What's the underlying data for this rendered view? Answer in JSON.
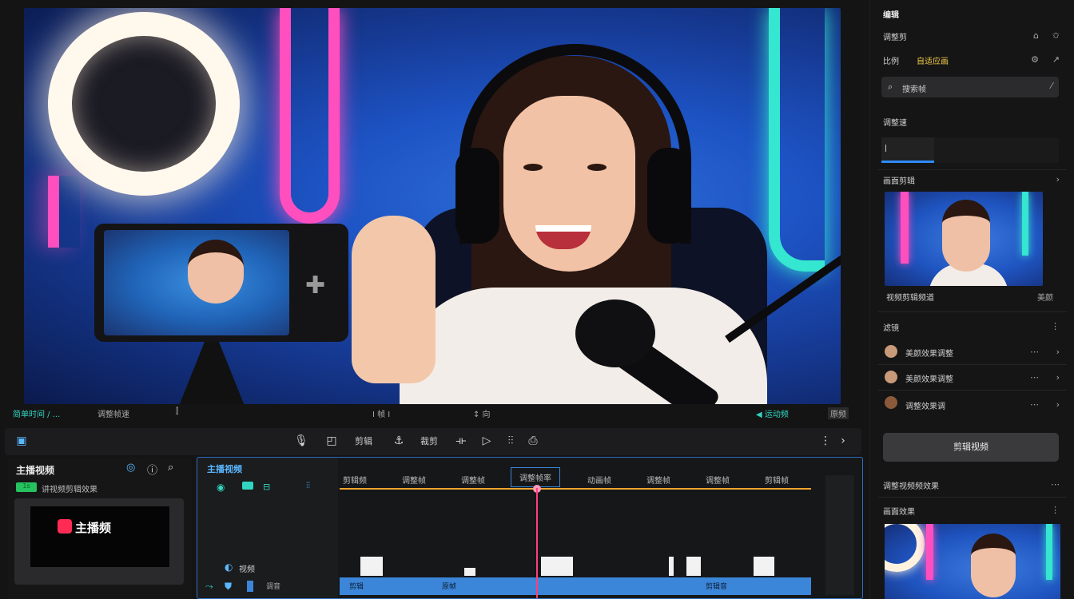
{
  "transport": {
    "left_time": "简单时间 / ...",
    "mode": "调整帧速",
    "center_time": "Ⅰ 帧 Ⅰ",
    "center_action": "↕ 向",
    "right_status": "◀ 运动频",
    "right_badge": "原频"
  },
  "toolbar": {
    "split": "剪辑",
    "crop": "裁剪",
    "speed": "▷",
    "audio": "⫶⫶"
  },
  "media_panel": {
    "title": "主播视频",
    "tag": "1s",
    "subtitle": "讲视频剪辑效果",
    "logo_text": "主播频"
  },
  "timeline": {
    "title": "主播视频",
    "track_label": "视频",
    "audio_label": "调音",
    "ruler": [
      "剪辑频",
      "调整帧",
      "调整帧",
      "调整帧率",
      "动画帧",
      "调整帧",
      "调整帧",
      "剪辑帧"
    ],
    "clip_labels": [
      "剪辑",
      "原帧",
      "剪辑音"
    ]
  },
  "right_panel": {
    "header": "编辑",
    "r1": "调整剪",
    "r2_left": "比例",
    "r2_tag": "自适应画",
    "search_text": "搜索帧",
    "section_speed": "调整速",
    "section_preview": "画面剪辑",
    "preview_caption": "视频剪辑频道",
    "preview_caption_right": "美颜",
    "section_list": "滤镜",
    "list": [
      {
        "label": "美颜效果调整"
      },
      {
        "label": "美颜效果调整"
      },
      {
        "label": "调整效果调"
      }
    ],
    "button": "剪辑视频",
    "footer_row": "调整视频频效果",
    "footer_section": "画面效果"
  },
  "colors": {
    "accent_teal": "#32d4c2",
    "timeline_border": "#2f6fbf",
    "playhead": "#ff3e7b",
    "ruler_line": "#f2a52c",
    "clip_blue": "#3b86d9"
  }
}
